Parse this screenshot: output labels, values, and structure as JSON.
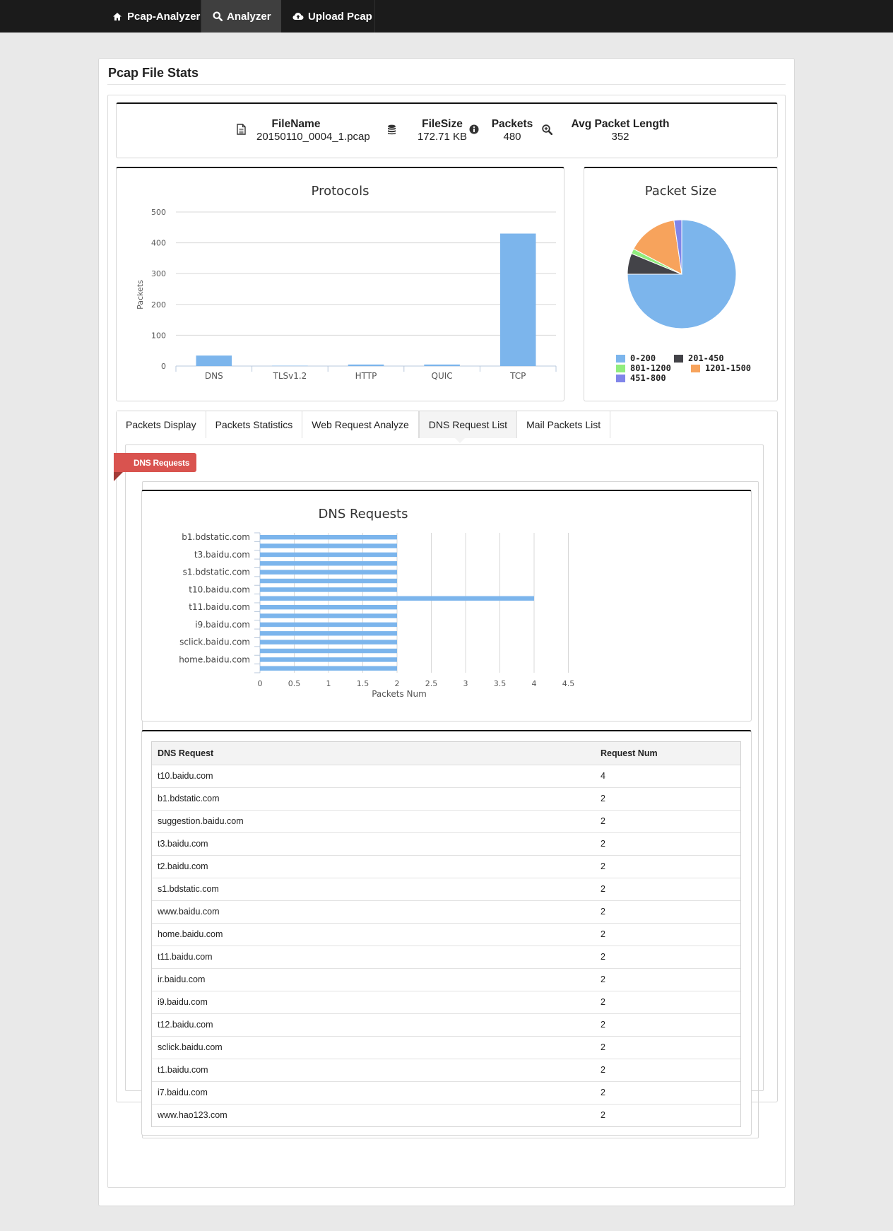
{
  "navbar": {
    "items": [
      {
        "label": "Pcap-Analyzer",
        "icon": "home-icon"
      },
      {
        "label": "Analyzer",
        "icon": "search-icon",
        "active": true
      },
      {
        "label": "Upload Pcap",
        "icon": "cloud-upload-icon"
      }
    ]
  },
  "page": {
    "title": "Pcap File Stats"
  },
  "stats": {
    "filename": {
      "label": "FileName",
      "value": "20150110_0004_1.pcap",
      "icon": "file-icon"
    },
    "filesize": {
      "label": "FileSize",
      "value": "172.71 KB",
      "icon": "database-icon"
    },
    "packets": {
      "label": "Packets",
      "value": "480",
      "icon": "info-icon"
    },
    "avg_len": {
      "label": "Avg Packet Length",
      "value": "352",
      "icon": "zoom-in-icon"
    }
  },
  "tabs": [
    "Packets Display",
    "Packets Statistics",
    "Web Request Analyze",
    "DNS Request List",
    "Mail Packets List"
  ],
  "active_tab": "DNS Request List",
  "ribbon": "DNS Requests",
  "chart_data": [
    {
      "type": "bar",
      "title": "Protocols",
      "ylabel": "Packets",
      "xlabel": "",
      "categories": [
        "DNS",
        "TLSv1.2",
        "HTTP",
        "QUIC",
        "TCP"
      ],
      "values": [
        34,
        1,
        5,
        5,
        430
      ],
      "ylim": [
        0,
        500
      ],
      "yticks": [
        "0",
        "100",
        "200",
        "300",
        "400",
        "500"
      ],
      "color": "#7cb5ec",
      "grid": true
    },
    {
      "type": "pie",
      "title": "Packet Size",
      "slices": [
        {
          "label": "0-200",
          "value": 75,
          "color": "#7cb5ec"
        },
        {
          "label": "201-450",
          "value": 6.2,
          "color": "#434348"
        },
        {
          "label": "801-1200",
          "value": 1.5,
          "color": "#90ed7d"
        },
        {
          "label": "1201-1500",
          "value": 15,
          "color": "#f7a35c"
        },
        {
          "label": "451-800",
          "value": 2.3,
          "color": "#8085e9"
        }
      ],
      "legend": "bottom"
    },
    {
      "type": "bar",
      "orientation": "horizontal",
      "title": "DNS Requests",
      "xlabel": "Packets Num",
      "xticks": [
        "0",
        "0.5",
        "1",
        "1.5",
        "2",
        "2.5",
        "3",
        "3.5",
        "4",
        "4.5"
      ],
      "xlim": [
        0,
        4.5
      ],
      "visible_category_labels": [
        "b1.bdstatic.com",
        "t3.baidu.com",
        "s1.bdstatic.com",
        "t10.baidu.com",
        "t11.baidu.com",
        "i9.baidu.com",
        "sclick.baidu.com",
        "home.baidu.com"
      ],
      "values": [
        2,
        2,
        2,
        2,
        2,
        2,
        2,
        4,
        2,
        2,
        2,
        2,
        2,
        2,
        2,
        2
      ],
      "color": "#7cb5ec",
      "grid": true
    }
  ],
  "dns_table": {
    "headers": [
      "DNS Request",
      "Request Num"
    ],
    "rows": [
      [
        "t10.baidu.com",
        "4"
      ],
      [
        "b1.bdstatic.com",
        "2"
      ],
      [
        "suggestion.baidu.com",
        "2"
      ],
      [
        "t3.baidu.com",
        "2"
      ],
      [
        "t2.baidu.com",
        "2"
      ],
      [
        "s1.bdstatic.com",
        "2"
      ],
      [
        "www.baidu.com",
        "2"
      ],
      [
        "home.baidu.com",
        "2"
      ],
      [
        "t11.baidu.com",
        "2"
      ],
      [
        "ir.baidu.com",
        "2"
      ],
      [
        "i9.baidu.com",
        "2"
      ],
      [
        "t12.baidu.com",
        "2"
      ],
      [
        "sclick.baidu.com",
        "2"
      ],
      [
        "t1.baidu.com",
        "2"
      ],
      [
        "i7.baidu.com",
        "2"
      ],
      [
        "www.hao123.com",
        "2"
      ]
    ]
  }
}
